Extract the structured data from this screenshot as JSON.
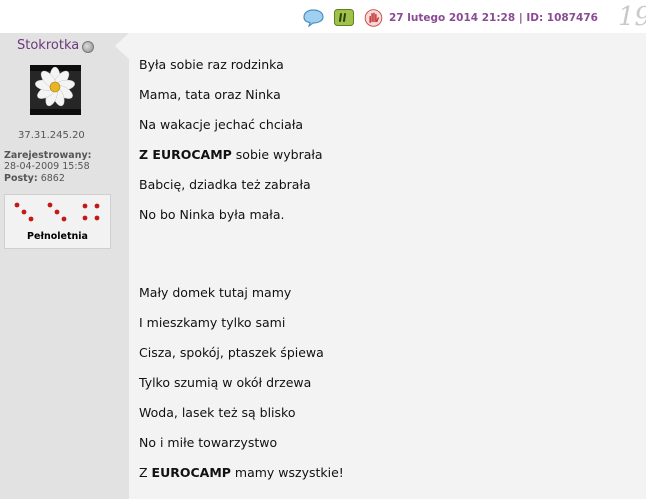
{
  "post": {
    "date": "27 lutego 2014 21:28",
    "separator": "|",
    "id_label": "ID: 1087476",
    "number": "19",
    "icons": [
      "speech-bubble-icon",
      "quote-icon",
      "report-hand-icon"
    ]
  },
  "user": {
    "name": "Stokrotka",
    "status": "offline",
    "ip": "37.31.245.20",
    "registered_label": "Zarejestrowany:",
    "registered_date": "28-04-2009 15:58",
    "posts_label": "Posty:",
    "posts_count": "6862",
    "rank": "Pełnoletnia",
    "rank_dice": [
      3,
      3,
      4
    ]
  },
  "content": {
    "lines": [
      {
        "text": "Była sobie raz rodzinka"
      },
      {
        "text": "Mama, tata oraz Ninka"
      },
      {
        "text": "Na wakacje jechać chciała"
      },
      {
        "bold": "Z EUROCAMP",
        "text": " sobie wybrała"
      },
      {
        "text": "Babcię, dziadka też zabrała"
      },
      {
        "text": "No bo Ninka była mała."
      },
      {
        "text": "Mały domek tutaj mamy"
      },
      {
        "text": "I mieszkamy tylko sami"
      },
      {
        "text": "Cisza, spokój, ptaszek śpiewa"
      },
      {
        "text": "Tylko szumią w okół drzewa"
      },
      {
        "text": "Woda, lasek też są blisko"
      },
      {
        "text": "No i miłe towarzystwo"
      },
      {
        "prefix": "Z ",
        "bold": "EUROCAMP",
        "text": " mamy wszystkie!"
      }
    ]
  },
  "colors": {
    "accent": "#8a4a94",
    "username": "#6b3a7a",
    "sidebar_bg": "#e2e2e2",
    "content_bg": "#f3f3f3"
  }
}
